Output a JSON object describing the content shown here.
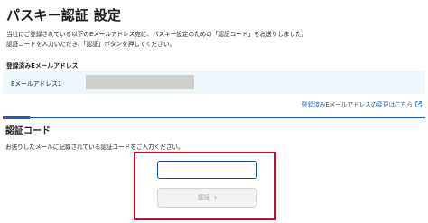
{
  "page": {
    "title": "パスキー認証 設定"
  },
  "intro": {
    "line1": "当社にご登録されている以下のEメールアドレス宛に、パスキー設定のための「認証コード」をお送りしました。",
    "line2": "認証コードを入力いただき、「認証」ボタンを押してください。"
  },
  "email_section": {
    "heading": "登録済みEメールアドレス",
    "label": "Eメールアドレス1",
    "change_link": "登録済みEメールアドレスの変更はこちら"
  },
  "code_section": {
    "heading": "認証コード",
    "description": "お送りしたメールに記載されている認証コードをご入力ください。",
    "input_value": "",
    "submit_label": "認証",
    "submit_icon": "chevron-right-icon"
  },
  "colors": {
    "link": "#1a5fb4",
    "highlight": "#c8102e",
    "email_box_bg": "#eef7fc"
  }
}
